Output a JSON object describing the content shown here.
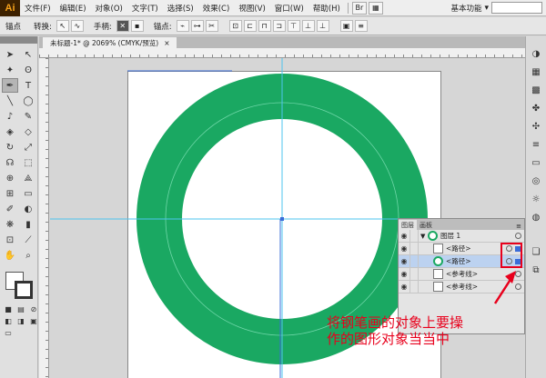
{
  "app": {
    "logo": "Ai",
    "workspace": "基本功能"
  },
  "menu": [
    "文件(F)",
    "编辑(E)",
    "对象(O)",
    "文字(T)",
    "选择(S)",
    "效果(C)",
    "视图(V)",
    "窗口(W)",
    "帮助(H)"
  ],
  "control_bar": {
    "anchor_label": "锚点",
    "convert_label": "转换:",
    "handle_label": "手柄:",
    "anchors_label": "锚点:"
  },
  "document": {
    "tab_title": "未标题-1* @ 2069% (CMYK/预览)",
    "close": "×"
  },
  "layers_panel": {
    "tabs": [
      "图层",
      "画板"
    ],
    "rows": [
      {
        "label": "图层 1",
        "thumb": "ring",
        "selected": false
      },
      {
        "label": "<路径>",
        "thumb": "plain",
        "selected": false
      },
      {
        "label": "<路径>",
        "thumb": "ring",
        "selected": true
      },
      {
        "label": "<参考线>",
        "thumb": "plain",
        "selected": false
      },
      {
        "label": "<参考线>",
        "thumb": "plain",
        "selected": false
      }
    ]
  },
  "annotation": {
    "line1": "将钢笔画的对象上要操",
    "line2": "作的图形对象当当中"
  },
  "colors": {
    "ring": "#1aa862",
    "guide": "#4ec4ef",
    "annotation": "#e8001c",
    "selection": "#3a6cd8"
  },
  "icons": {
    "tools": [
      "selection-arrow",
      "direct-selection",
      "magic-wand",
      "lasso",
      "pen",
      "type",
      "line",
      "ellipse",
      "paintbrush",
      "pencil",
      "blob-brush",
      "eraser",
      "rotate",
      "scale",
      "warp",
      "free-transform",
      "shape-builder",
      "perspective",
      "mesh",
      "gradient",
      "eyedropper",
      "blend",
      "symbol-sprayer",
      "column-graph",
      "artboard",
      "slice",
      "hand",
      "zoom"
    ],
    "dock": [
      "color",
      "color-guide",
      "swatches",
      "brushes",
      "symbols",
      "stroke",
      "gradient",
      "transparency",
      "appearance",
      "graphic-styles",
      "layers",
      "artboards"
    ]
  }
}
